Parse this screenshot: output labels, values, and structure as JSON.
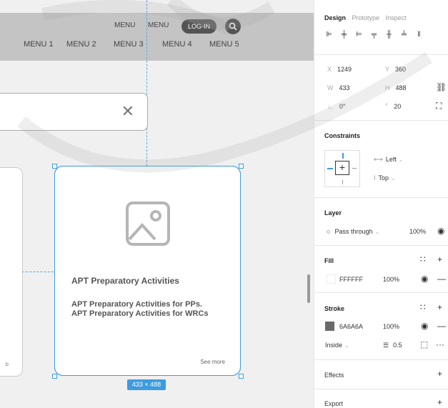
{
  "canvas": {
    "nav": {
      "top_links": [
        "MENU",
        "MENU"
      ],
      "login": "LOG-IN",
      "menu_items": [
        "MENU 1",
        "MENU 2",
        "MENU 3",
        "MENU 4",
        "MENU 5"
      ]
    },
    "modal": {
      "close_glyph": "✕"
    },
    "left_card_text": "b",
    "card": {
      "title": "APT Preparatory Activities",
      "desc_line1": "APT Preparatory Activities for PPs.",
      "desc_line2": "APT Preparatory Activities for WRCs",
      "see_more": "See more"
    },
    "dimension_badge": "433 × 488"
  },
  "panel": {
    "tabs": [
      "Design",
      "Prototype",
      "Inspect"
    ],
    "active_tab": "Design",
    "position": {
      "x_label": "X",
      "x": "1249",
      "y_label": "Y",
      "y": "360"
    },
    "size": {
      "w_label": "W",
      "w": "433",
      "h_label": "H",
      "h": "488"
    },
    "rotation": {
      "label": "∟",
      "value": "0°"
    },
    "radius": {
      "label": "⌜",
      "value": "20"
    },
    "constraints": {
      "title": "Constraints",
      "horizontal": "Left",
      "vertical": "Top"
    },
    "layer": {
      "title": "Layer",
      "blend": "Pass through",
      "opacity": "100%"
    },
    "fill": {
      "title": "Fill",
      "hex": "FFFFFF",
      "opacity": "100%",
      "color": "#FFFFFF"
    },
    "stroke": {
      "title": "Stroke",
      "hex": "6A6A6A",
      "opacity": "100%",
      "color": "#6A6A6A",
      "position": "Inside",
      "weight": "0.5"
    },
    "effects": {
      "title": "Effects"
    },
    "export": {
      "title": "Export"
    }
  },
  "colors": {
    "accent": "#3D9BE0",
    "nav_bg": "#C4C4C4",
    "pill": "#555555"
  }
}
